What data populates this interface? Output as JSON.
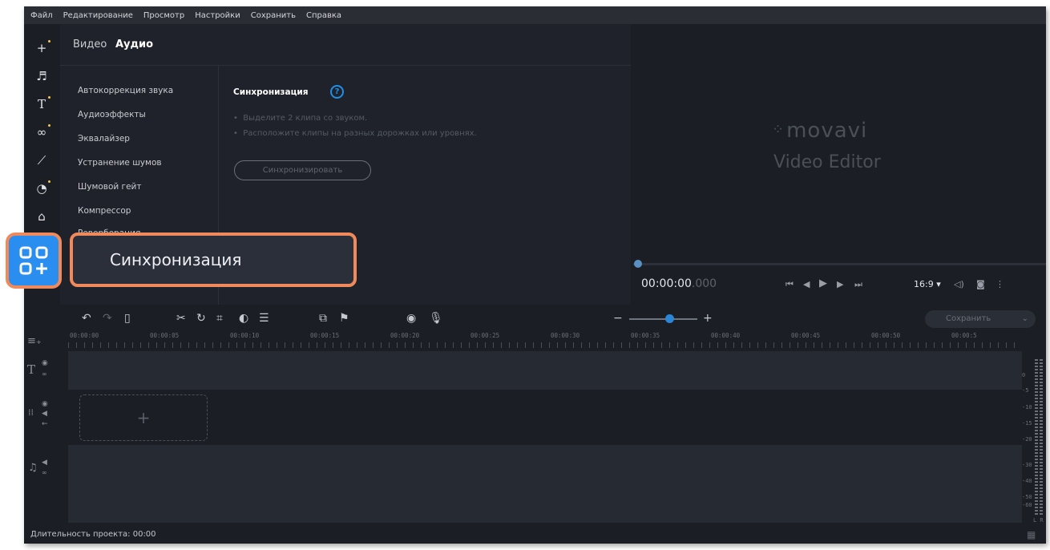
{
  "menubar": {
    "items": [
      "Файл",
      "Редактирование",
      "Просмотр",
      "Настройки",
      "Сохранить",
      "Справка"
    ]
  },
  "toolbar_left": {
    "icons": [
      "import-plus-icon",
      "music-icon",
      "titles-icon",
      "transitions-icon",
      "filters-icon",
      "stickers-icon",
      "callouts-icon",
      "more-tools-icon"
    ]
  },
  "panel": {
    "tabs": [
      "Видео",
      "Аудио"
    ],
    "effects": [
      "Автокоррекция звука",
      "Аудиоэффекты",
      "Эквалайзер",
      "Устранение шумов",
      "Шумовой гейт",
      "Компрессор",
      "Реверберация"
    ],
    "sync_title": "Синхронизация",
    "help_icon": "?",
    "instructions": [
      "Выделите 2 клипа со звуком.",
      "Расположите клипы на разных дорожках или уровнях."
    ],
    "sync_button": "Синхронизировать"
  },
  "preview": {
    "logo": "movavi",
    "logo_sub": "Video Editor",
    "timecode": "00:00:00",
    "timecode_ms": ".000",
    "aspect": "16:9"
  },
  "timeline": {
    "save_button": "Сохранить",
    "ruler": [
      "00:00:00",
      "00:00:05",
      "00:00:10",
      "00:00:15",
      "00:00:20",
      "00:00:25",
      "00:00:30",
      "00:00:35",
      "00:00:40",
      "00:00:45",
      "00:00:50",
      "00:00:5"
    ],
    "add_clip": "+",
    "meter": [
      "0",
      "-5",
      "-10",
      "-15",
      "-20",
      "-30",
      "-40",
      "-50",
      "-60"
    ],
    "meter_lr": "L  R"
  },
  "status": {
    "duration": "Длительность проекта: 00:00"
  },
  "callout": {
    "label": "Синхронизация"
  },
  "colors": {
    "accent": "#2a8ef0",
    "callout_border": "#f08a5d",
    "background": "#1b1e25"
  }
}
